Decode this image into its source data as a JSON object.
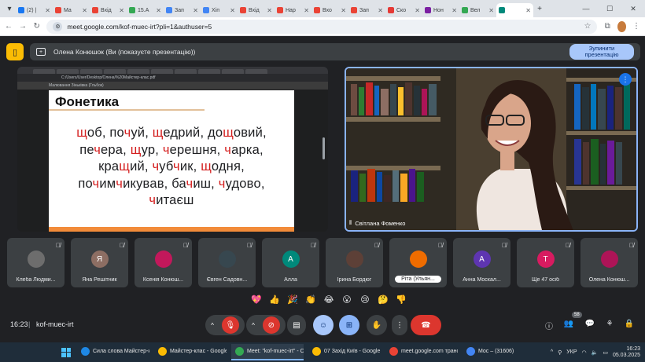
{
  "browser": {
    "tabs": [
      {
        "label": "(2) |",
        "color": "#1877f2"
      },
      {
        "label": "Ma",
        "color": "#ea4335"
      },
      {
        "label": "Вхід",
        "color": "#ea4335"
      },
      {
        "label": "15.A",
        "color": "#34a853"
      },
      {
        "label": "Зап",
        "color": "#4285f4"
      },
      {
        "label": "Хіп",
        "color": "#4285f4"
      },
      {
        "label": "Вхід",
        "color": "#ea4335"
      },
      {
        "label": "Нар",
        "color": "#ea4335"
      },
      {
        "label": "Вхо",
        "color": "#ea4335"
      },
      {
        "label": "Зап",
        "color": "#ea4335"
      },
      {
        "label": "Ско",
        "color": "#e53935"
      },
      {
        "label": "Нон",
        "color": "#7b1fa2"
      },
      {
        "label": "Вел",
        "color": "#34a853"
      },
      {
        "label": "",
        "color": "#00897b"
      }
    ],
    "url": "meet.google.com/kof-muec-irt?pli=1&authuser=5"
  },
  "presentation_bar": {
    "text": "Олена Конюшок (Ви (показуєте презентацію))",
    "stop_label_1": "Зупинити",
    "stop_label_2": "презентацію"
  },
  "shared_screen": {
    "inner_url": "C:/Users/User/Desktop/Олена/%20Майстер-клас.pdf",
    "inner_toolbar": "Малювання     Зіньківка (Гльбок)",
    "slide_title": "Фонетика",
    "lines": [
      [
        {
          "t": "щ",
          "r": true
        },
        {
          "t": "об, по"
        },
        {
          "t": "ч",
          "r": true
        },
        {
          "t": "уй, "
        },
        {
          "t": "щ",
          "r": true
        },
        {
          "t": "едрий, до"
        },
        {
          "t": "щ",
          "r": true
        },
        {
          "t": "овий,"
        }
      ],
      [
        {
          "t": "пе"
        },
        {
          "t": "ч",
          "r": true
        },
        {
          "t": "ера, "
        },
        {
          "t": "щ",
          "r": true
        },
        {
          "t": "ур, "
        },
        {
          "t": "ч",
          "r": true
        },
        {
          "t": "ерешня, "
        },
        {
          "t": "ч",
          "r": true
        },
        {
          "t": "арка,"
        }
      ],
      [
        {
          "t": "кра"
        },
        {
          "t": "щ",
          "r": true
        },
        {
          "t": "ий, "
        },
        {
          "t": "ч",
          "r": true
        },
        {
          "t": "уб"
        },
        {
          "t": "ч",
          "r": true
        },
        {
          "t": "ик, "
        },
        {
          "t": "щ",
          "r": true
        },
        {
          "t": "одня,"
        }
      ],
      [
        {
          "t": "по"
        },
        {
          "t": "ч",
          "r": true
        },
        {
          "t": "им"
        },
        {
          "t": "ч",
          "r": true
        },
        {
          "t": "икував, ба"
        },
        {
          "t": "ч",
          "r": true
        },
        {
          "t": "иш, "
        },
        {
          "t": "ч",
          "r": true
        },
        {
          "t": "удово,"
        }
      ],
      [
        {
          "t": "ч",
          "r": true
        },
        {
          "t": "итаєш"
        }
      ]
    ]
  },
  "speaker": {
    "name": "Світлана Фоменко"
  },
  "participants": [
    {
      "name": "Клеба Людми...",
      "initial": "",
      "color": "#6d6d6d",
      "photo": true
    },
    {
      "name": "Яна Решітник",
      "initial": "Я",
      "color": "#8d6e63",
      "photo": false
    },
    {
      "name": "Ксенія Конюш...",
      "initial": "",
      "color": "#c2185b",
      "photo": true
    },
    {
      "name": "Євген Садовн...",
      "initial": "",
      "color": "#37474f",
      "photo": true
    },
    {
      "name": "Алла",
      "initial": "А",
      "color": "#00897b",
      "photo": false
    },
    {
      "name": "Ірина Бордюг",
      "initial": "",
      "color": "#5d4037",
      "photo": true
    },
    {
      "name": "Рiта (Ульян...",
      "initial": "",
      "color": "#ef6c00",
      "photo": true
    },
    {
      "name": "Анна Москал...",
      "initial": "А",
      "color": "#5e35b1",
      "photo": false
    },
    {
      "name": "Ще 47 осіб",
      "initial": "T",
      "color": "#d81b60",
      "photo": false
    },
    {
      "name": "Олена Конюш...",
      "initial": "",
      "color": "#ad1457",
      "photo": true
    }
  ],
  "reactions": [
    "💖",
    "👍",
    "🎉",
    "👏",
    "😂",
    "😮",
    "😢",
    "🤔",
    "👎"
  ],
  "controls": {
    "time": "16:23",
    "meeting_code": "kof-muec-irt",
    "participants_count": "58"
  },
  "taskbar": {
    "apps": [
      {
        "label": "Сила слова Майстер-к...",
        "color": "#1e88e5",
        "active": false
      },
      {
        "label": "Майстер-клас - Google",
        "color": "#fbbc04",
        "active": false
      },
      {
        "label": "Meet: \"kof-muec-irt\" - C",
        "color": "#34a853",
        "active": true
      },
      {
        "label": "07 Захід Київ - Google ...",
        "color": "#fbbc04",
        "active": false
      },
      {
        "label": "meet.google.com трансл...",
        "color": "#ea4335",
        "active": false
      },
      {
        "label": "Мос – (31606)",
        "color": "#4285f4",
        "active": false
      }
    ],
    "lang": "УКР",
    "clock_time": "16:23",
    "clock_date": "05.03.2025"
  }
}
